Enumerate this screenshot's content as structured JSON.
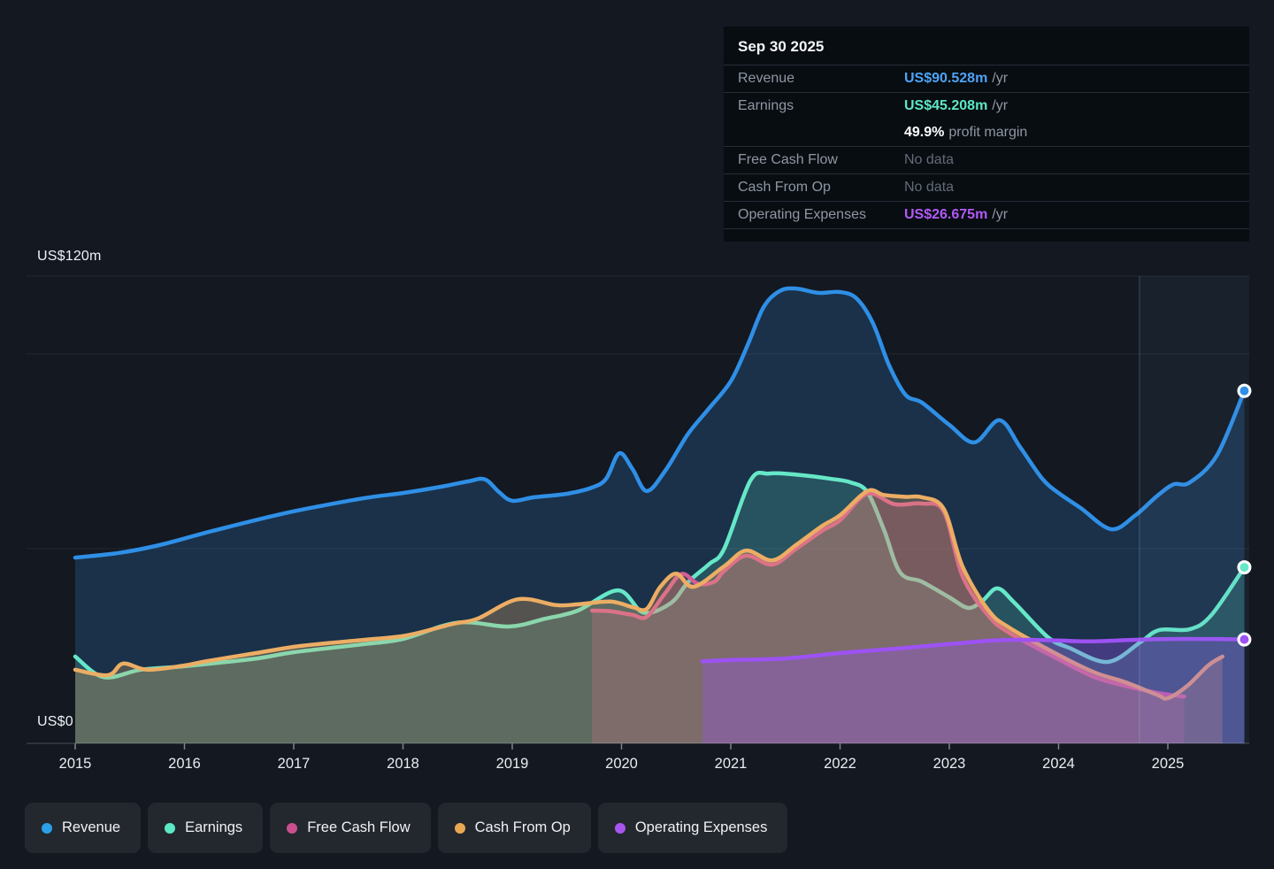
{
  "colors": {
    "page_bg": "#131821",
    "revenue": "#2f8fe6",
    "earnings": "#66e7c8",
    "fcf": "#d55c95",
    "cashop": "#ecad64",
    "opex": "#9d52f3",
    "tooltip_revenue_value": "#4fa3f5",
    "tooltip_earnings_value": "#5ce8c5",
    "tooltip_opex_value": "#b25af7",
    "tooltip_label": "#8f97a3",
    "tooltip_nodata": "#636b77",
    "white": "#ffffff",
    "grid": "rgba(255,255,255,0.07)",
    "axis": "rgba(255,255,255,0.16)",
    "tick": "#7b828c",
    "tick_text": "#e9edf1",
    "forecast_line": "rgba(170,200,235,0.18)",
    "forecast_band": "rgba(115,155,215,0.07)"
  },
  "tooltip": {
    "date": "Sep 30 2025",
    "revenue": {
      "label": "Revenue",
      "value": "US$90.528m",
      "suffix": "/yr"
    },
    "earnings": {
      "label": "Earnings",
      "value": "US$45.208m",
      "suffix": "/yr"
    },
    "margin": {
      "value": "49.9%",
      "suffix": "profit margin"
    },
    "fcf": {
      "label": "Free Cash Flow",
      "value": "No data"
    },
    "cashop": {
      "label": "Cash From Op",
      "value": "No data"
    },
    "opex": {
      "label": "Operating Expenses",
      "value": "US$26.675m",
      "suffix": "/yr"
    }
  },
  "legend": {
    "items": [
      {
        "label": "Revenue",
        "color": "#2b9fe8"
      },
      {
        "label": "Earnings",
        "color": "#5be8c4"
      },
      {
        "label": "Free Cash Flow",
        "color": "#c94f8e"
      },
      {
        "label": "Cash From Op",
        "color": "#e8a852"
      },
      {
        "label": "Operating Expenses",
        "color": "#a855ed"
      }
    ]
  },
  "chart_data": {
    "type": "area",
    "unit": "US$ millions per year",
    "x_ticks": [
      2015,
      2016,
      2017,
      2018,
      2019,
      2020,
      2021,
      2022,
      2023,
      2024,
      2025
    ],
    "y_axis": {
      "top_label": "US$120m",
      "bottom_label": "US$0",
      "max": 120,
      "min": 0,
      "gridline_values": [
        120,
        100,
        50
      ]
    },
    "forecast_boundary_year": 2024.74,
    "series": [
      {
        "name": "Revenue",
        "color": "#2f8fe6",
        "fill": "rgba(47,125,194,0.25)",
        "end_dot": true,
        "points": [
          [
            2015.0,
            47.7
          ],
          [
            2015.4,
            48.9
          ],
          [
            2015.77,
            50.9
          ],
          [
            2016.25,
            54.5
          ],
          [
            2016.84,
            58.6
          ],
          [
            2017.2,
            60.7
          ],
          [
            2017.65,
            63.0
          ],
          [
            2018.0,
            64.3
          ],
          [
            2018.35,
            65.9
          ],
          [
            2018.6,
            67.3
          ],
          [
            2018.75,
            67.8
          ],
          [
            2018.88,
            64.5
          ],
          [
            2019.0,
            62.3
          ],
          [
            2019.2,
            63.2
          ],
          [
            2019.5,
            64.1
          ],
          [
            2019.73,
            65.7
          ],
          [
            2019.86,
            68.0
          ],
          [
            2019.98,
            74.5
          ],
          [
            2020.1,
            70.5
          ],
          [
            2020.23,
            64.8
          ],
          [
            2020.4,
            70.0
          ],
          [
            2020.61,
            79.5
          ],
          [
            2020.8,
            86.0
          ],
          [
            2021.0,
            93.0
          ],
          [
            2021.15,
            102.0
          ],
          [
            2021.3,
            112.0
          ],
          [
            2021.45,
            116.2
          ],
          [
            2021.6,
            116.8
          ],
          [
            2021.8,
            115.7
          ],
          [
            2022.0,
            115.9
          ],
          [
            2022.15,
            114.3
          ],
          [
            2022.3,
            108.0
          ],
          [
            2022.45,
            97.0
          ],
          [
            2022.6,
            89.5
          ],
          [
            2022.75,
            87.5
          ],
          [
            2023.0,
            81.8
          ],
          [
            2023.23,
            77.3
          ],
          [
            2023.46,
            83.0
          ],
          [
            2023.65,
            76.0
          ],
          [
            2023.85,
            68.0
          ],
          [
            2024.0,
            64.3
          ],
          [
            2024.2,
            60.5
          ],
          [
            2024.48,
            55.0
          ],
          [
            2024.7,
            58.5
          ],
          [
            2024.9,
            63.5
          ],
          [
            2025.05,
            66.5
          ],
          [
            2025.2,
            67.0
          ],
          [
            2025.45,
            74.0
          ],
          [
            2025.7,
            90.528
          ]
        ]
      },
      {
        "name": "Earnings",
        "color": "#66e7c8",
        "fill": "rgba(102,231,200,0.18)",
        "end_dot": true,
        "points": [
          [
            2015.0,
            22.3
          ],
          [
            2015.26,
            17.0
          ],
          [
            2015.6,
            18.9
          ],
          [
            2016.0,
            19.8
          ],
          [
            2016.66,
            21.8
          ],
          [
            2017.0,
            23.4
          ],
          [
            2017.65,
            25.5
          ],
          [
            2018.0,
            26.8
          ],
          [
            2018.5,
            31.0
          ],
          [
            2018.97,
            30.0
          ],
          [
            2019.3,
            32.0
          ],
          [
            2019.6,
            34.1
          ],
          [
            2019.97,
            39.3
          ],
          [
            2020.2,
            33.6
          ],
          [
            2020.45,
            36.0
          ],
          [
            2020.61,
            41.4
          ],
          [
            2020.8,
            46.0
          ],
          [
            2020.94,
            50.0
          ],
          [
            2021.18,
            67.5
          ],
          [
            2021.35,
            69.3
          ],
          [
            2021.6,
            69.0
          ],
          [
            2021.9,
            68.0
          ],
          [
            2022.1,
            67.0
          ],
          [
            2022.25,
            64.5
          ],
          [
            2022.4,
            55.0
          ],
          [
            2022.55,
            43.9
          ],
          [
            2022.75,
            41.5
          ],
          [
            2023.0,
            37.5
          ],
          [
            2023.17,
            34.8
          ],
          [
            2023.3,
            36.5
          ],
          [
            2023.44,
            39.8
          ],
          [
            2023.6,
            36.0
          ],
          [
            2023.9,
            27.3
          ],
          [
            2024.1,
            24.5
          ],
          [
            2024.45,
            20.9
          ],
          [
            2024.75,
            26.0
          ],
          [
            2024.92,
            29.1
          ],
          [
            2025.2,
            29.3
          ],
          [
            2025.4,
            33.0
          ],
          [
            2025.7,
            45.208
          ]
        ]
      },
      {
        "name": "Free Cash Flow",
        "color": "#d55c95",
        "fill": "rgba(213,92,149,0.26)",
        "end_dot": false,
        "points": [
          [
            2019.73,
            34.1
          ],
          [
            2019.9,
            33.9
          ],
          [
            2020.1,
            33.0
          ],
          [
            2020.23,
            32.5
          ],
          [
            2020.4,
            38.6
          ],
          [
            2020.55,
            43.5
          ],
          [
            2020.7,
            41.0
          ],
          [
            2020.85,
            41.5
          ],
          [
            2020.94,
            44.3
          ],
          [
            2021.14,
            48.2
          ],
          [
            2021.38,
            45.9
          ],
          [
            2021.6,
            50.0
          ],
          [
            2021.83,
            54.5
          ],
          [
            2022.0,
            57.3
          ],
          [
            2022.25,
            64.1
          ],
          [
            2022.5,
            61.4
          ],
          [
            2022.75,
            61.6
          ],
          [
            2022.95,
            59.5
          ],
          [
            2023.12,
            43.0
          ],
          [
            2023.36,
            32.7
          ],
          [
            2023.56,
            28.2
          ],
          [
            2024.0,
            21.6
          ],
          [
            2024.33,
            17.0
          ],
          [
            2024.61,
            14.8
          ],
          [
            2024.9,
            13.0
          ],
          [
            2025.15,
            12.0
          ]
        ]
      },
      {
        "name": "Cash From Op",
        "color": "#ecad64",
        "fill": "rgba(236,173,100,0.28)",
        "end_dot": false,
        "points": [
          [
            2015.0,
            18.9
          ],
          [
            2015.3,
            17.5
          ],
          [
            2015.44,
            20.5
          ],
          [
            2015.66,
            18.9
          ],
          [
            2016.0,
            20.0
          ],
          [
            2016.2,
            21.1
          ],
          [
            2016.66,
            23.2
          ],
          [
            2017.06,
            25.0
          ],
          [
            2017.65,
            26.6
          ],
          [
            2018.03,
            27.7
          ],
          [
            2018.46,
            30.7
          ],
          [
            2018.68,
            32.0
          ],
          [
            2019.05,
            37.0
          ],
          [
            2019.4,
            35.5
          ],
          [
            2019.6,
            35.7
          ],
          [
            2019.9,
            36.4
          ],
          [
            2020.1,
            35.0
          ],
          [
            2020.23,
            34.5
          ],
          [
            2020.35,
            40.0
          ],
          [
            2020.5,
            43.6
          ],
          [
            2020.66,
            40.2
          ],
          [
            2020.94,
            45.5
          ],
          [
            2021.14,
            49.5
          ],
          [
            2021.38,
            47.0
          ],
          [
            2021.6,
            51.0
          ],
          [
            2021.83,
            55.7
          ],
          [
            2022.0,
            58.6
          ],
          [
            2022.25,
            64.8
          ],
          [
            2022.4,
            63.8
          ],
          [
            2022.6,
            63.3
          ],
          [
            2022.75,
            63.2
          ],
          [
            2022.95,
            60.2
          ],
          [
            2023.12,
            45.5
          ],
          [
            2023.36,
            34.1
          ],
          [
            2023.56,
            29.5
          ],
          [
            2024.0,
            22.7
          ],
          [
            2024.33,
            18.2
          ],
          [
            2024.61,
            15.7
          ],
          [
            2024.9,
            12.5
          ],
          [
            2025.0,
            11.6
          ],
          [
            2025.18,
            14.8
          ],
          [
            2025.37,
            20.0
          ],
          [
            2025.5,
            22.3
          ]
        ]
      },
      {
        "name": "Operating Expenses",
        "color": "#9d52f3",
        "fill": "rgba(157,82,243,0.32)",
        "end_dot": true,
        "points": [
          [
            2020.74,
            21.1
          ],
          [
            2021.0,
            21.4
          ],
          [
            2021.5,
            21.8
          ],
          [
            2022.0,
            23.2
          ],
          [
            2022.5,
            24.3
          ],
          [
            2023.0,
            25.5
          ],
          [
            2023.4,
            26.4
          ],
          [
            2023.7,
            26.6
          ],
          [
            2024.0,
            26.4
          ],
          [
            2024.3,
            26.2
          ],
          [
            2024.7,
            26.6
          ],
          [
            2025.0,
            26.8
          ],
          [
            2025.4,
            26.8
          ],
          [
            2025.7,
            26.675
          ]
        ]
      }
    ]
  }
}
